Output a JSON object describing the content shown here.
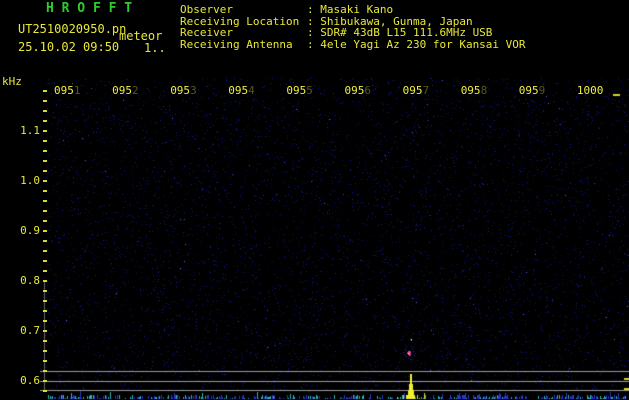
{
  "header": {
    "app_title": "H R O F F T",
    "filename": "UT2510020950.pn",
    "filename_overlay": "meteor",
    "datetime": "25.10.02 09:50",
    "counter": "1..",
    "info_rows": [
      {
        "label": "Observer",
        "value": ": Masaki Kano"
      },
      {
        "label": "Receiving Location",
        "value": ": Shibukawa, Gunma, Japan"
      },
      {
        "label": "Receiver",
        "value": ": SDR# 43dB L15 111.6MHz USB"
      },
      {
        "label": "Receiving Antenna",
        "value": ": 4ele Yagi Az 230 for Kansai VOR"
      }
    ]
  },
  "spectrogram": {
    "freq_unit": "kHz",
    "freq_tick_labels": [
      "1.1",
      "1.0",
      "0.9",
      "0.8",
      "0.7",
      "0.6"
    ],
    "time_tick_labels": [
      "0951",
      "0952",
      "0953",
      "0954",
      "0955",
      "0956",
      "0957",
      "0958",
      "0959",
      "1000"
    ],
    "meteor_echo": {
      "approx_time": "0957",
      "approx_freq_khz": 0.65
    },
    "level_spike": {
      "approx_time": "0957"
    },
    "colors": {
      "title_green": "#2ecc2e",
      "text_yellow": "#e8e83a",
      "grid_grey": "#9a9a9a",
      "spike_yellow": "#f0f030",
      "echo_red": "#ff3030",
      "echo_magenta": "#ff50ff",
      "echo_yellow": "#ffff44",
      "level_tick_cyan": "#2fb3b3",
      "level_tick_blue": "#2b36c9"
    }
  }
}
